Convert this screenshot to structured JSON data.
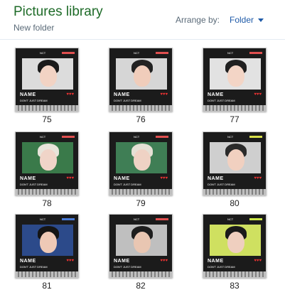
{
  "header": {
    "title": "Pictures library",
    "subtitle": "New folder",
    "arrange_label": "Arrange by:",
    "arrange_value": "Folder"
  },
  "thumb_text": {
    "name": "NAME",
    "tagline": "DON'T JUST DREAM",
    "tag": "NCT",
    "hearts": "♥♥♥"
  },
  "items": [
    {
      "label": "75",
      "bg": "#dcdcdc",
      "skin": "#f2d3c4",
      "hair": "#1b1b1b",
      "accent": "#e05050"
    },
    {
      "label": "76",
      "bg": "#d6d6d6",
      "skin": "#f0cdbb",
      "hair": "#222222",
      "accent": "#e05050"
    },
    {
      "label": "77",
      "bg": "#e2e2e2",
      "skin": "#f3d5c6",
      "hair": "#202020",
      "accent": "#e05050"
    },
    {
      "label": "78",
      "bg": "#3a7a4a",
      "skin": "#f0d4c8",
      "hair": "#e8e4da",
      "accent": "#e05050"
    },
    {
      "label": "79",
      "bg": "#3f7e55",
      "skin": "#efd2c4",
      "hair": "#e5e0d5",
      "accent": "#e05050"
    },
    {
      "label": "80",
      "bg": "#cfcfcf",
      "skin": "#f1d0c0",
      "hair": "#2a2a2a",
      "accent": "#d8e04a"
    },
    {
      "label": "81",
      "bg": "#2c4a8a",
      "skin": "#eec9b6",
      "hair": "#151515",
      "accent": "#4a7bd8"
    },
    {
      "label": "82",
      "bg": "#bfbfbf",
      "skin": "#e9c6b2",
      "hair": "#1e1e1e",
      "accent": "#e05050"
    },
    {
      "label": "83",
      "bg": "#cfe060",
      "skin": "#efcfbf",
      "hair": "#1a1a1a",
      "accent": "#cde84a"
    }
  ]
}
